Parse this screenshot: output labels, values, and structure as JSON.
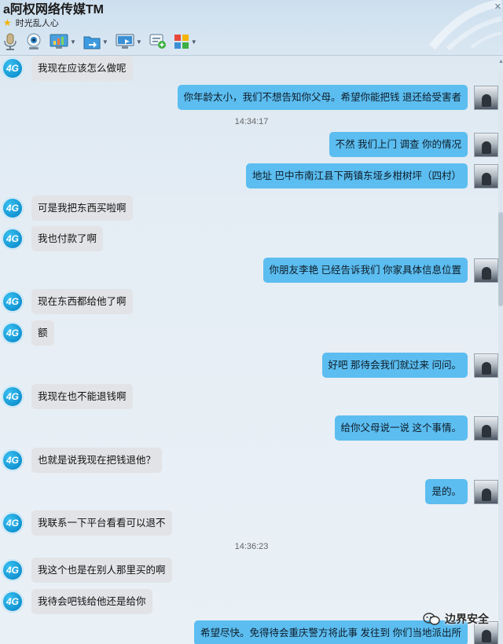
{
  "window": {
    "title": "a阿权网络传媒TM",
    "signature": "时光乱人心"
  },
  "toolbar": {
    "items": [
      {
        "icon": "microphone-icon"
      },
      {
        "icon": "webcam-icon"
      },
      {
        "icon": "chart-app-icon"
      },
      {
        "icon": "file-transfer-icon"
      },
      {
        "icon": "remote-desktop-icon"
      },
      {
        "icon": "add-message-icon"
      },
      {
        "icon": "apps-grid-icon"
      }
    ]
  },
  "messages": [
    {
      "side": "left",
      "text": "我现在应该怎么做呢"
    },
    {
      "side": "right",
      "text": "你年龄太小，我们不想告知你父母。希望你能把钱 退还给受害者"
    },
    {
      "side": "time",
      "text": "14:34:17"
    },
    {
      "side": "right",
      "text": "不然 我们上门 调查 你的情况"
    },
    {
      "side": "right",
      "text": "地址 巴中市南江县下两镇东垭乡柑树坪（四村）"
    },
    {
      "side": "left",
      "text": "可是我把东西买啦啊"
    },
    {
      "side": "left",
      "text": "我也付款了啊"
    },
    {
      "side": "right",
      "text": "你朋友李艳 已经告诉我们 你家具体信息位置"
    },
    {
      "side": "left",
      "text": "现在东西都给他了啊"
    },
    {
      "side": "left",
      "text": "额"
    },
    {
      "side": "right",
      "text": "好吧 那待会我们就过来 问问。"
    },
    {
      "side": "left",
      "text": "我现在也不能退钱啊"
    },
    {
      "side": "right",
      "text": "给你父母说一说 这个事情。"
    },
    {
      "side": "left",
      "text": "也就是说我现在把钱退他？"
    },
    {
      "side": "right",
      "text": "是的。"
    },
    {
      "side": "left",
      "text": "我联系一下平台看看可以退不"
    },
    {
      "side": "time",
      "text": "14:36:23"
    },
    {
      "side": "left",
      "text": "我这个也是在别人那里买的啊"
    },
    {
      "side": "left",
      "text": "我待会吧钱给他还是给你"
    },
    {
      "side": "right",
      "text": "希望尽快。免得待会重庆警方将此事 发往到 你们当地派出所"
    }
  ],
  "avatars": {
    "left_badge": "4G"
  },
  "watermark": "边界安全",
  "colors": {
    "left_bubble": "#e2e3e6",
    "right_bubble": "#5cbdf0"
  }
}
